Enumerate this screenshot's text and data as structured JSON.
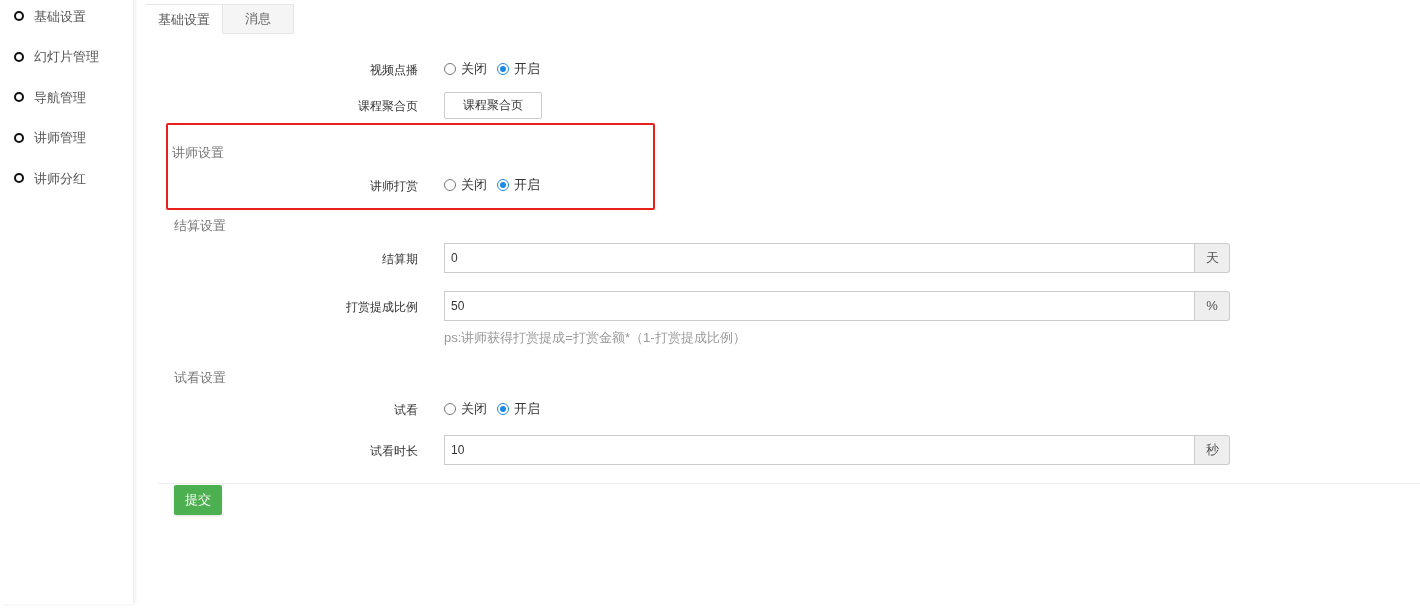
{
  "sidebar": {
    "items": [
      {
        "label": "基础设置"
      },
      {
        "label": "幻灯片管理"
      },
      {
        "label": "导航管理"
      },
      {
        "label": "讲师管理"
      },
      {
        "label": "讲师分红"
      }
    ]
  },
  "tabs": [
    {
      "label": "基础设置",
      "selected": true
    },
    {
      "label": "消息",
      "selected": false
    }
  ],
  "sections": [
    {
      "highlighted": false,
      "fields": [
        {
          "kind": "radio",
          "label": "视频点播",
          "options": [
            {
              "label": "关闭",
              "selected": false
            },
            {
              "label": "开启",
              "selected": true
            }
          ]
        },
        {
          "kind": "button",
          "label": "课程聚合页",
          "button": "课程聚合页"
        }
      ]
    },
    {
      "title": "讲师设置",
      "highlighted": true,
      "fields": [
        {
          "kind": "radio",
          "label": "讲师打赏",
          "options": [
            {
              "label": "关闭",
              "selected": false
            },
            {
              "label": "开启",
              "selected": true
            }
          ]
        }
      ]
    },
    {
      "title": "结算设置",
      "highlighted": false,
      "fields": [
        {
          "kind": "input",
          "label": "结算期",
          "value": "0",
          "addon": "天"
        },
        {
          "kind": "input",
          "label": "打赏提成比例",
          "value": "50",
          "addon": "%",
          "note": "ps:讲师获得打赏提成=打赏金额*（1-打赏提成比例）"
        }
      ]
    },
    {
      "title": "试看设置",
      "highlighted": false,
      "fields": [
        {
          "kind": "radio",
          "label": "试看",
          "options": [
            {
              "label": "关闭",
              "selected": false
            },
            {
              "label": "开启",
              "selected": true
            }
          ]
        },
        {
          "kind": "input",
          "label": "试看时长",
          "value": "10",
          "addon": "秒"
        }
      ]
    }
  ],
  "submit": "提交"
}
